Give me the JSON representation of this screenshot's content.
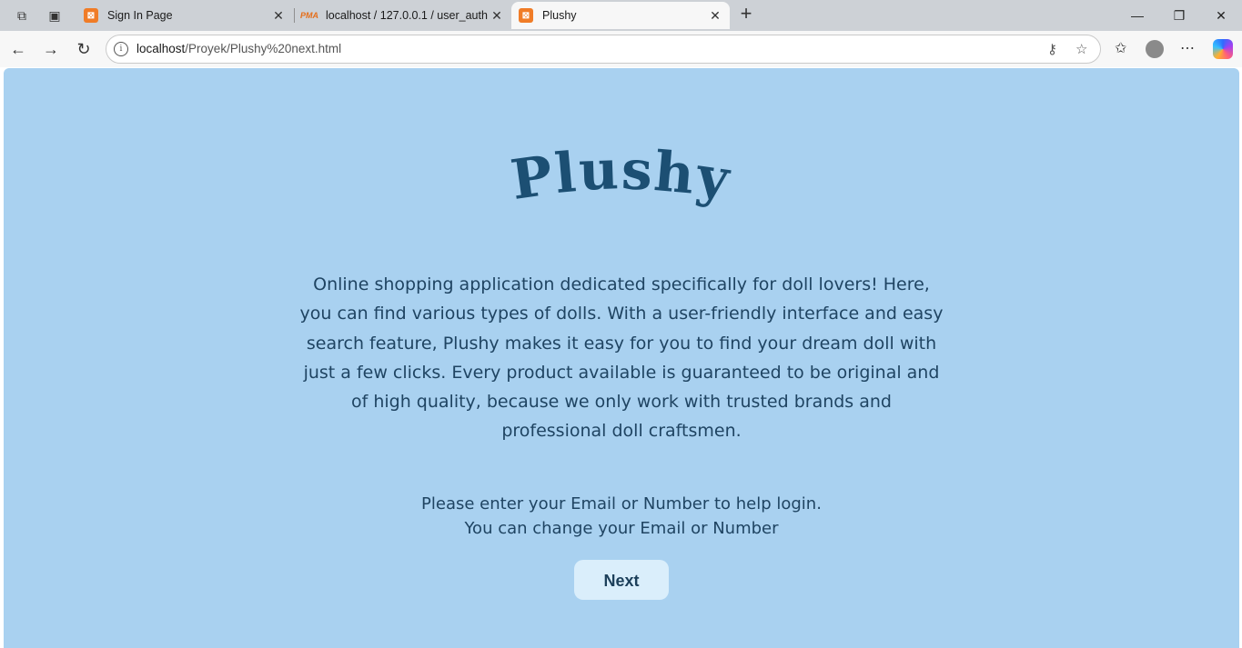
{
  "browser": {
    "tabs": [
      {
        "title": "Sign In Page",
        "favicon": "xampp-icon"
      },
      {
        "title": "localhost / 127.0.0.1 / user_auth / ",
        "favicon": "phpmyadmin-icon"
      },
      {
        "title": "Plushy",
        "favicon": "xampp-icon",
        "active": true
      }
    ],
    "address": {
      "host": "localhost",
      "path": "/Proyek/Plushy%20next.html"
    }
  },
  "page": {
    "logo": "Plushy",
    "background_color": "#a9d1f0",
    "description": "Online shopping application dedicated specifically for doll lovers! Here, you can find various types of dolls. With a user-friendly interface and easy search feature, Plushy makes it easy for you to find your dream doll with just a few clicks. Every product available is guaranteed to be original and of high quality, because we only work with trusted brands and professional doll craftsmen.",
    "prompt_line1": "Please enter your Email or Number to help login.",
    "prompt_line2": "You can change your Email or Number",
    "next_label": "Next"
  }
}
